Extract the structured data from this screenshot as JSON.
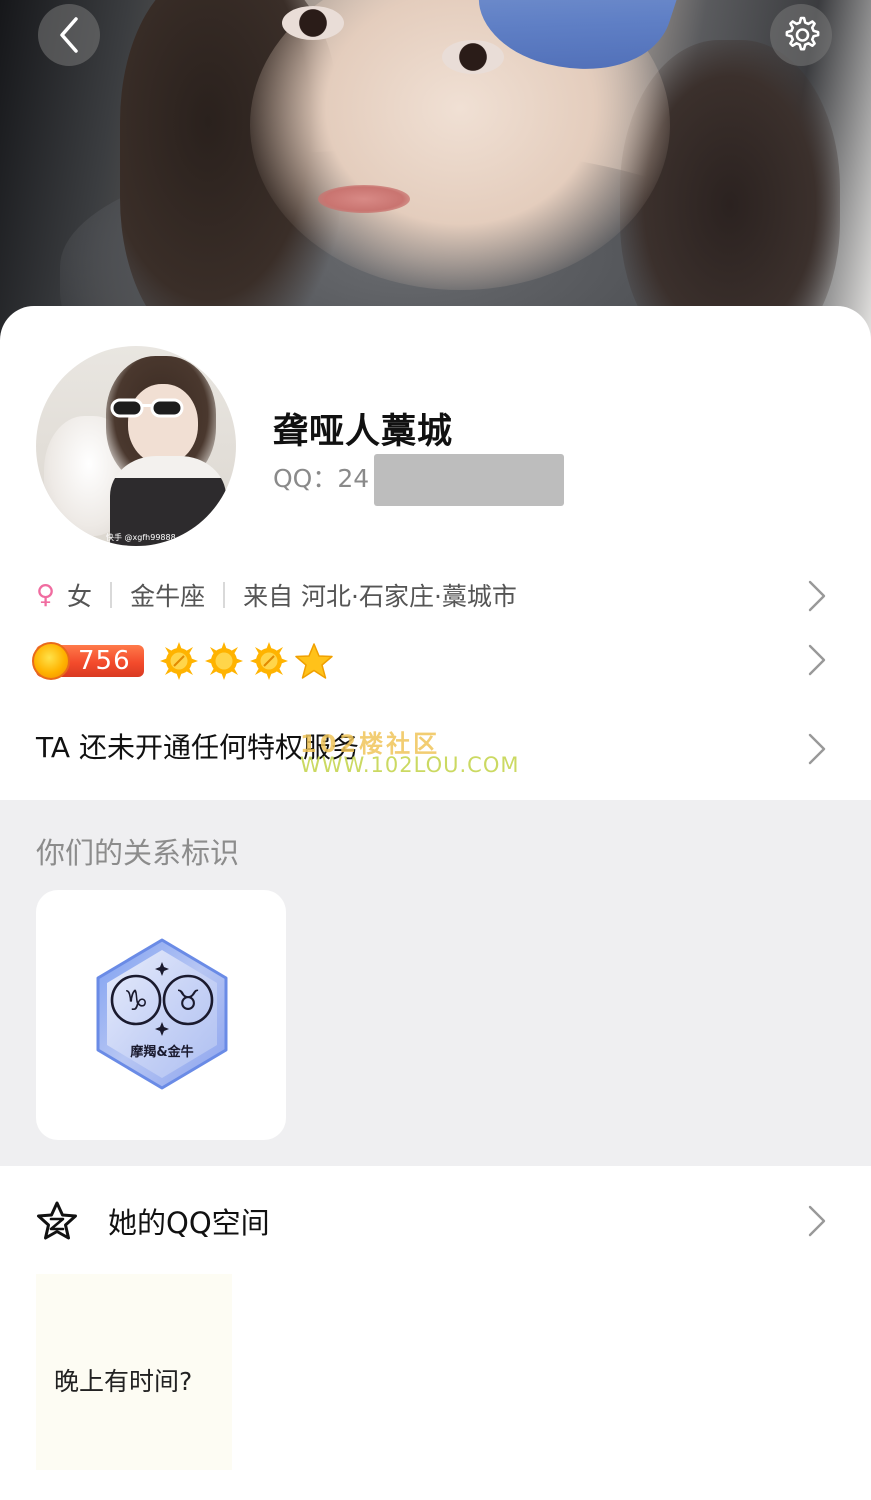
{
  "header": {
    "back_icon": "chevron-left-icon",
    "settings_icon": "gear-icon"
  },
  "profile": {
    "nickname": "聋哑人藁城",
    "qq_label": "QQ：24",
    "avatar_watermark": "快手 @xgfh99888"
  },
  "info": {
    "gender_icon": "female-icon",
    "gender_symbol": "♀",
    "gender": "女",
    "constellation": "金牛座",
    "location": "来自 河北·石家庄·藁城市"
  },
  "level": {
    "value": "756",
    "suns": 3,
    "stars": 1,
    "colors": {
      "pill": "#f34b2c",
      "sun": "#ffb300",
      "star": "#ffc21a"
    }
  },
  "privilege": {
    "text": "TA 还未开通任何特权服务"
  },
  "watermark": {
    "line1": "102楼社区",
    "line2": "WWW.102LOU.COM"
  },
  "relation": {
    "title": "你们的关系标识",
    "badge_label": "摩羯&金牛",
    "badge_symbols": [
      "♑",
      "♉"
    ]
  },
  "qzone": {
    "icon": "star-badge-icon",
    "label": "她的QQ空间",
    "posts": [
      {
        "text": "晚上有时间?"
      }
    ]
  },
  "colors": {
    "section_bg": "#efeff1",
    "female": "#f06ca0",
    "secondary_text": "#8c8c8c"
  }
}
